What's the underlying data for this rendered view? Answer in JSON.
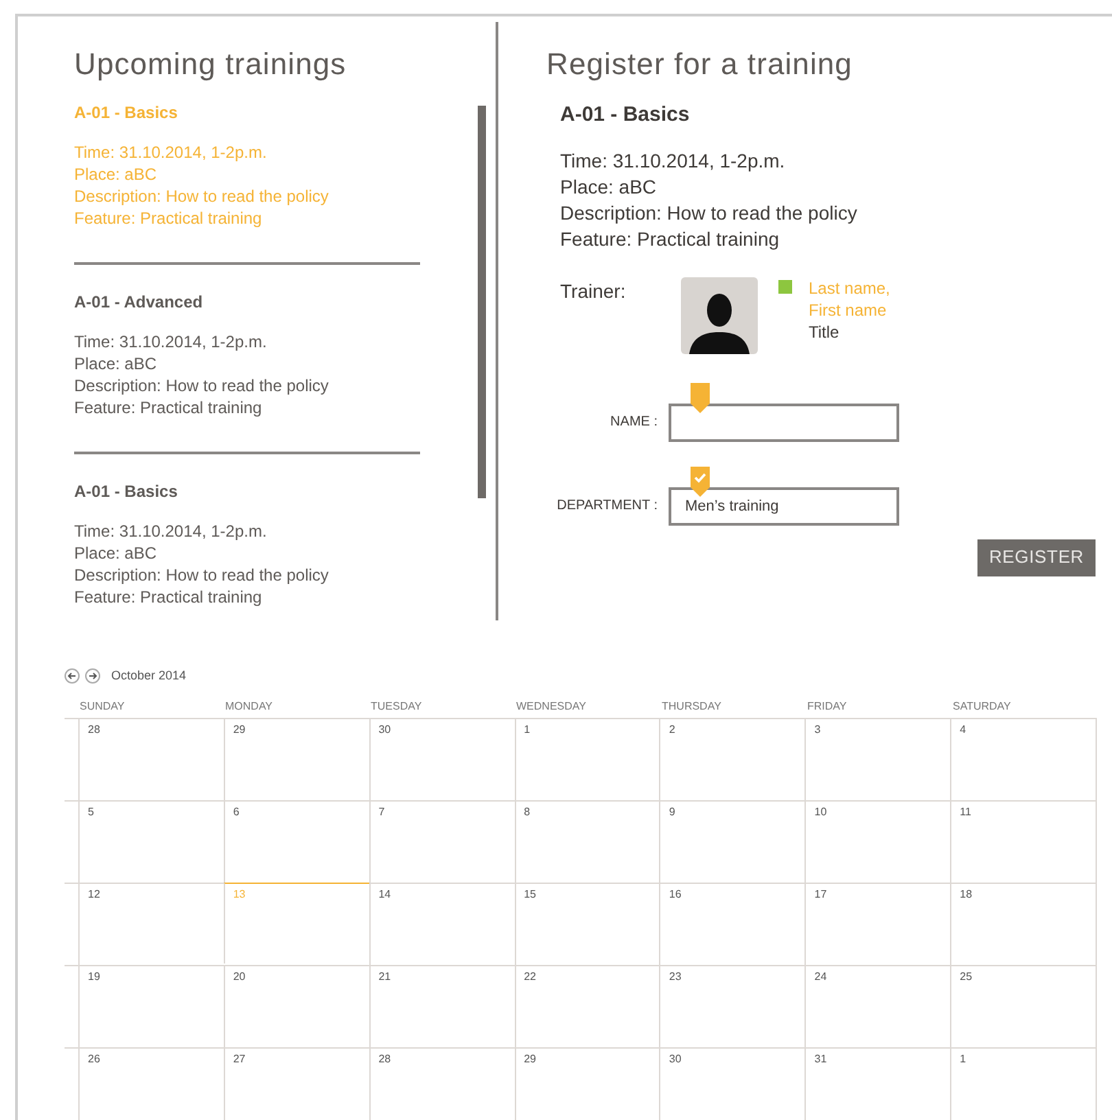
{
  "upcoming": {
    "title": "Upcoming trainings",
    "trainings": [
      {
        "name": "A-01 - Basics",
        "selected": true,
        "lines": [
          "Time: 31.10.2014, 1-2p.m.",
          "Place: aBC",
          "Description: How to read the policy",
          "Feature: Practical training"
        ]
      },
      {
        "name": "A-01 - Advanced",
        "selected": false,
        "lines": [
          "Time: 31.10.2014, 1-2p.m.",
          "Place: aBC",
          "Description: How to read the policy",
          "Feature: Practical training"
        ]
      },
      {
        "name": "A-01 - Basics",
        "selected": false,
        "lines": [
          "Time: 31.10.2014, 1-2p.m.",
          "Place: aBC",
          "Description: How to read the policy",
          "Feature: Practical training"
        ]
      }
    ]
  },
  "register": {
    "title": "Register for a training",
    "training_name": "A-01 - Basics",
    "lines": [
      "Time: 31.10.2014, 1-2p.m.",
      "Place: aBC",
      "Description: How to read the policy",
      "Feature: Practical training"
    ],
    "trainer": {
      "label": "Trainer:",
      "color": "#8dc63f",
      "name_lines": [
        "Last name,",
        "First name"
      ],
      "title": "Title"
    },
    "fields": [
      {
        "label": "NAME :",
        "checked": false
      },
      {
        "label": "DEPARTMENT :",
        "value": "Men’s training",
        "checked": true
      }
    ],
    "button": "REGISTER"
  },
  "calendar": {
    "month": "October 2014",
    "weekdays": [
      "SUNDAY",
      "MONDAY",
      "TUESDAY",
      "WEDNESDAY",
      "THURSDAY",
      "FRIDAY",
      "SATURDAY"
    ],
    "weeks": [
      [
        {
          "day": "28",
          "today": false
        },
        {
          "day": "29",
          "today": false
        },
        {
          "day": "30",
          "today": false
        },
        {
          "day": "1",
          "today": false
        },
        {
          "day": "2",
          "today": false
        },
        {
          "day": "3",
          "today": false
        },
        {
          "day": "4",
          "today": false
        }
      ],
      [
        {
          "day": "5",
          "today": false
        },
        {
          "day": "6",
          "today": false
        },
        {
          "day": "7",
          "today": false
        },
        {
          "day": "8",
          "today": false
        },
        {
          "day": "9",
          "today": false
        },
        {
          "day": "10",
          "today": false
        },
        {
          "day": "11",
          "today": false
        }
      ],
      [
        {
          "day": "12",
          "today": false
        },
        {
          "day": "13",
          "today": true
        },
        {
          "day": "14",
          "today": false
        },
        {
          "day": "15",
          "today": false
        },
        {
          "day": "16",
          "today": false
        },
        {
          "day": "17",
          "today": false
        },
        {
          "day": "18",
          "today": false
        }
      ],
      [
        {
          "day": "19",
          "today": false
        },
        {
          "day": "20",
          "today": false
        },
        {
          "day": "21",
          "today": false
        },
        {
          "day": "22",
          "today": false
        },
        {
          "day": "23",
          "today": false
        },
        {
          "day": "24",
          "today": false
        },
        {
          "day": "25",
          "today": false
        }
      ],
      [
        {
          "day": "26",
          "today": false
        },
        {
          "day": "27",
          "today": false
        },
        {
          "day": "28",
          "today": false
        },
        {
          "day": "29",
          "today": false
        },
        {
          "day": "30",
          "today": false
        },
        {
          "day": "31",
          "today": false
        },
        {
          "day": "1",
          "today": false
        }
      ]
    ]
  }
}
